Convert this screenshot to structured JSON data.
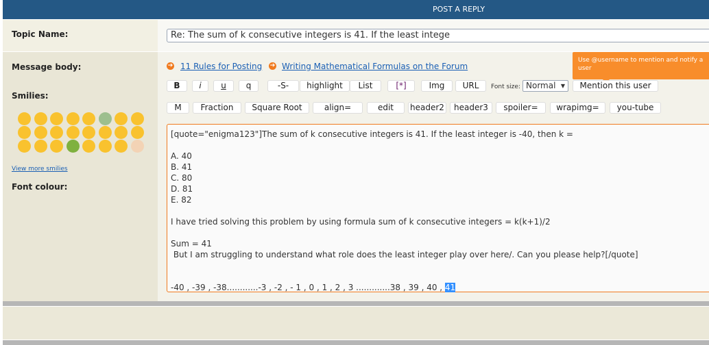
{
  "header": {
    "title": "POST A REPLY"
  },
  "topic": {
    "label": "Topic Name:",
    "value": "Re: The sum of k consecutive integers is 41. If the least intege"
  },
  "left": {
    "message_body": "Message body:",
    "smilies": "Smilies:",
    "view_more": "View more smilies",
    "font_colour": "Font colour:"
  },
  "links": [
    {
      "label": "11 Rules for Posting"
    },
    {
      "label": "Writing Mathematical Formulas on the Forum"
    }
  ],
  "tooltip": "Use @username to mention and notify a user",
  "toolbar1": [
    "B",
    "i",
    "u",
    "q",
    "-S-",
    "highlight",
    "List",
    "[*]",
    "Img",
    "URL"
  ],
  "font_size": {
    "label": "Font size:",
    "value": "Normal"
  },
  "mention_button": "Mention this user",
  "toolbar2": [
    "M",
    "Fraction",
    "Square Root",
    "align=",
    "edit",
    "header2",
    "header3",
    "spoiler=",
    "wrapimg=",
    "you-tube"
  ],
  "message": {
    "text": "[quote=\"enigma123\"]The sum of k consecutive integers is 41. If the least integer is -40, then k =\n\nA. 40\nB. 41\nC. 80\nD. 81\nE. 82\n\nI have tried solving this problem by using formula sum of k consecutive integers = k(k+1)/2\n\nSum = 41\n But I am struggling to understand what role does the least integer play over here/. Can you please help?[/quote]\n\n\n-40 , -39 , -38............-3 , -2 , - 1 , 0 , 1 , 2 , 3 .............38 , 39 , 40 , ",
    "selected": "41"
  },
  "colors": {
    "header": "#245885",
    "accent": "#f07a1e",
    "tooltip": "#f88d2b",
    "link": "#1a5fb4"
  },
  "smilies": [
    "smile",
    "grin",
    "joy",
    "worried",
    "wink",
    "sick",
    "confused",
    "cool",
    "grinning",
    "angry",
    "rolling",
    "flushed",
    "crying",
    "sleeping",
    "eye-roll",
    "neutral",
    "astonished",
    "scream",
    "dizzy",
    "nauseated",
    "innocent",
    "expressionless",
    "bandage",
    "thumbs-up"
  ]
}
